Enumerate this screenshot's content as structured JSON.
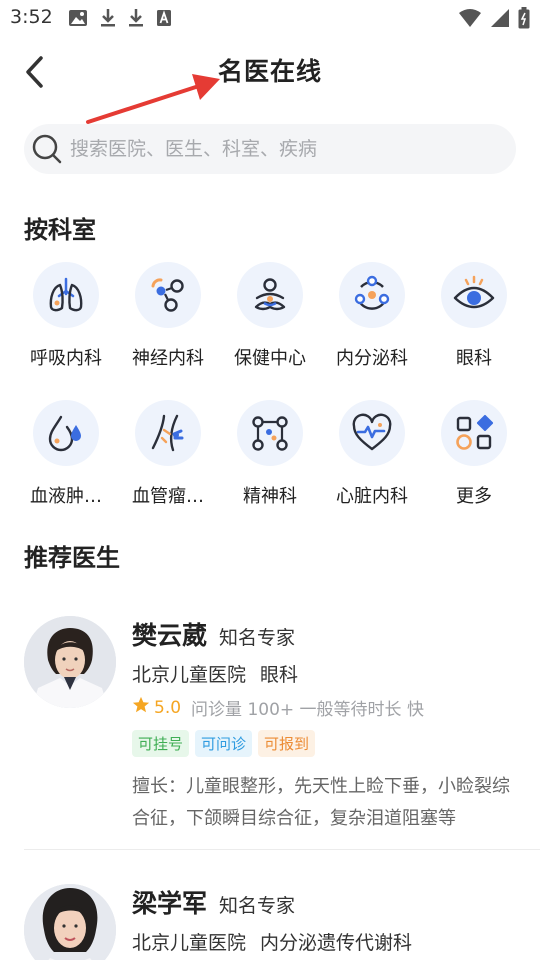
{
  "status_bar": {
    "time": "3:52",
    "left_icons": [
      "image-icon",
      "download-icon",
      "download-icon",
      "text-icon"
    ],
    "right_icons": [
      "wifi-icon",
      "signal-icon",
      "battery-icon"
    ]
  },
  "header": {
    "title": "名医在线"
  },
  "search": {
    "placeholder": "搜索医院、医生、科室、疾病"
  },
  "departments": {
    "title": "按科室",
    "items": [
      {
        "label": "呼吸内科",
        "icon": "lungs-icon"
      },
      {
        "label": "神经内科",
        "icon": "neuron-icon"
      },
      {
        "label": "保健中心",
        "icon": "meditation-icon"
      },
      {
        "label": "内分泌科",
        "icon": "endocrine-icon"
      },
      {
        "label": "眼科",
        "icon": "eye-icon"
      },
      {
        "label": "血液肿…",
        "icon": "blood-drop-icon"
      },
      {
        "label": "血管瘤…",
        "icon": "vessel-icon"
      },
      {
        "label": "精神科",
        "icon": "network-icon"
      },
      {
        "label": "心脏内科",
        "icon": "heart-icon"
      },
      {
        "label": "更多",
        "icon": "more-grid-icon"
      }
    ]
  },
  "recommended": {
    "title": "推荐医生",
    "doctors": [
      {
        "name": "樊云葳",
        "title": "知名专家",
        "hospital": "北京儿童医院",
        "department": "眼科",
        "rating": "5.0",
        "stats": "问诊量 100+ 一般等待时长 快",
        "tags": [
          "可挂号",
          "可问诊",
          "可报到"
        ],
        "specialty": "擅长：儿童眼整形，先天性上睑下垂，小睑裂综合征，下颌瞬目综合征，复杂泪道阻塞等"
      },
      {
        "name": "梁学军",
        "title": "知名专家",
        "hospital": "北京儿童医院",
        "department": "内分泌遗传代谢科"
      }
    ]
  },
  "colors": {
    "accent_blue": "#3b6de0",
    "accent_orange": "#f5a25a",
    "icon_bg": "#eef3fc",
    "rating_star": "#f5a623"
  }
}
